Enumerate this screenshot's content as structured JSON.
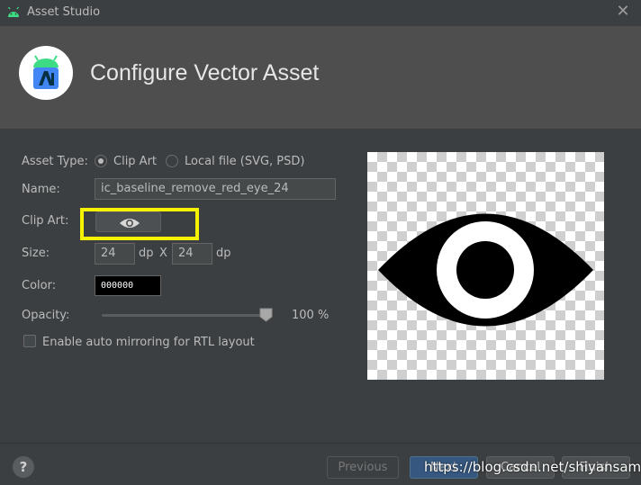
{
  "window": {
    "title": "Asset Studio",
    "close_glyph": "✕"
  },
  "header": {
    "heading": "Configure Vector Asset"
  },
  "form": {
    "asset_type_label": "Asset Type:",
    "asset_type_options": [
      "Clip Art",
      "Local file (SVG, PSD)"
    ],
    "asset_type_selected": "Clip Art",
    "name_label": "Name:",
    "name_value": "ic_baseline_remove_red_eye_24",
    "clip_art_label": "Clip Art:",
    "clip_art_icon": "eye-icon",
    "size_label": "Size:",
    "size_width": "24",
    "size_height": "24",
    "size_unit": "dp",
    "size_separator": "X",
    "color_label": "Color:",
    "color_value": "000000",
    "opacity_label": "Opacity:",
    "opacity_percent": 100,
    "opacity_text": "100 %",
    "rtl_label": "Enable auto mirroring for RTL layout",
    "rtl_checked": false
  },
  "preview": {
    "icon": "eye-icon"
  },
  "footer": {
    "help_glyph": "?",
    "previous_label": "Previous",
    "next_label": "Next",
    "cancel_label": "Cancel",
    "finish_label": "Finish",
    "watermark": "https://blog.csdn.net/shiyansama"
  },
  "colors": {
    "accent": "#365880",
    "highlight": "#f6f300",
    "background": "#3c3f41"
  }
}
